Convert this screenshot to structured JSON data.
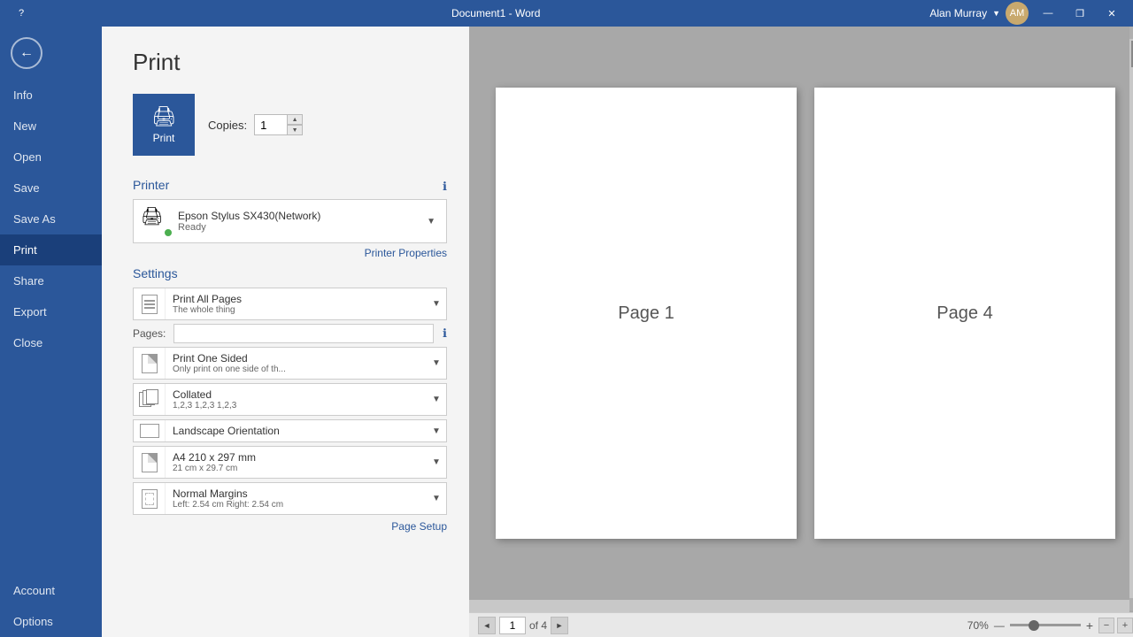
{
  "titlebar": {
    "title": "Document1 - Word",
    "user": "Alan Murray",
    "controls": {
      "minimize": "—",
      "restore": "❐",
      "close": "✕",
      "help": "?"
    }
  },
  "sidebar": {
    "back_label": "←",
    "items": [
      {
        "id": "info",
        "label": "Info"
      },
      {
        "id": "new",
        "label": "New"
      },
      {
        "id": "open",
        "label": "Open"
      },
      {
        "id": "save",
        "label": "Save"
      },
      {
        "id": "save-as",
        "label": "Save As"
      },
      {
        "id": "print",
        "label": "Print",
        "active": true
      },
      {
        "id": "share",
        "label": "Share"
      },
      {
        "id": "export",
        "label": "Export"
      },
      {
        "id": "close",
        "label": "Close"
      },
      {
        "id": "account",
        "label": "Account"
      },
      {
        "id": "options",
        "label": "Options"
      }
    ]
  },
  "print": {
    "title": "Print",
    "copies_label": "Copies:",
    "copies_value": "1",
    "print_button_label": "Print",
    "printer_section_title": "Printer",
    "printer_name": "Epson Stylus SX430(Network)",
    "printer_status": "Ready",
    "printer_properties_link": "Printer Properties",
    "settings_section_title": "Settings",
    "settings": [
      {
        "id": "pages-setting",
        "main": "Print All Pages",
        "sub": "The whole thing"
      },
      {
        "id": "sided-setting",
        "main": "Print One Sided",
        "sub": "Only print on one side of th..."
      },
      {
        "id": "collated-setting",
        "main": "Collated",
        "sub": "1,2,3   1,2,3   1,2,3"
      },
      {
        "id": "orientation-setting",
        "main": "Landscape Orientation",
        "sub": ""
      },
      {
        "id": "paper-setting",
        "main": "A4 210 x 297 mm",
        "sub": "21 cm x 29.7 cm"
      },
      {
        "id": "margins-setting",
        "main": "Normal Margins",
        "sub": "Left: 2.54 cm   Right: 2.54 cm"
      }
    ],
    "pages_label": "Pages:",
    "pages_placeholder": "",
    "page_setup_link": "Page Setup"
  },
  "preview": {
    "pages": [
      {
        "id": "page1",
        "label": "Page 1"
      },
      {
        "id": "page4",
        "label": "Page 4"
      }
    ],
    "current_page": "1",
    "total_pages": "4",
    "of_label": "of 4",
    "zoom_label": "70%",
    "nav_prev": "◄",
    "nav_next": "►"
  }
}
